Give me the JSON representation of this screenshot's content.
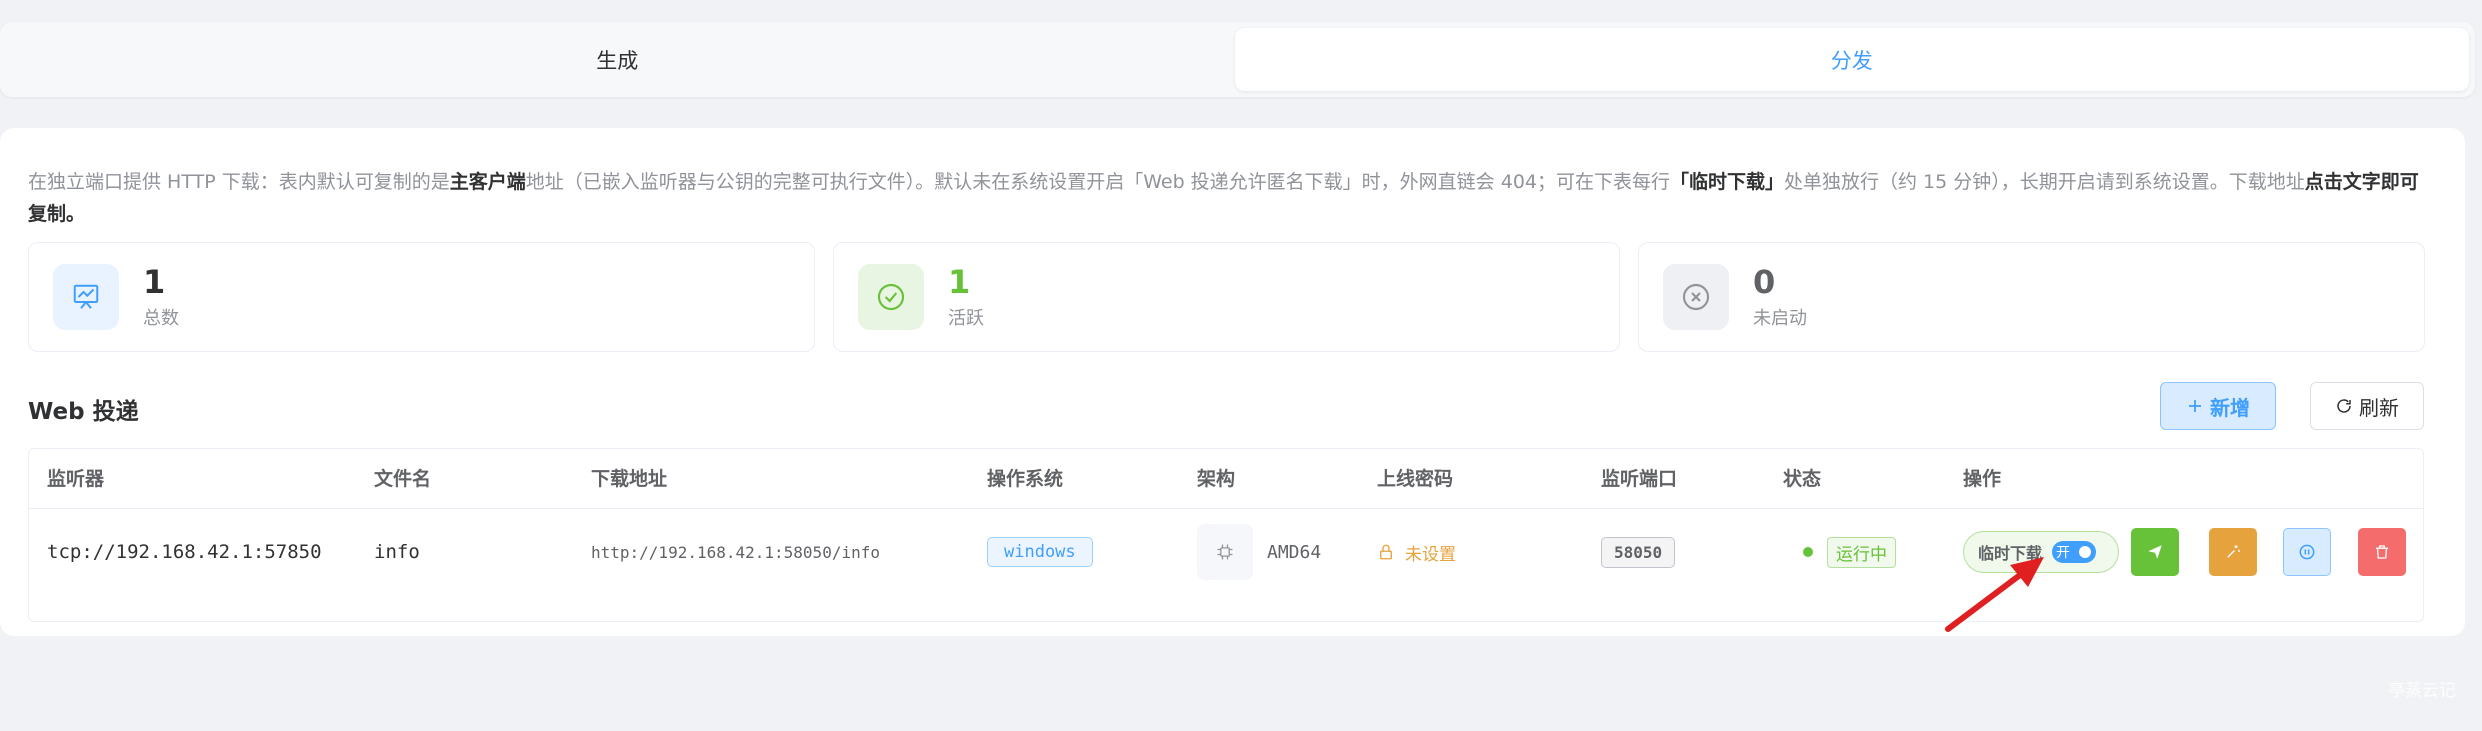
{
  "tabs": [
    {
      "label": "生成",
      "active": false
    },
    {
      "label": "分发",
      "active": true
    }
  ],
  "description": {
    "p1": "在独立端口提供 HTTP 下载：表内默认可复制的是",
    "b1": "主客户端",
    "p2": "地址（已嵌入监听器与公钥的完整可执行文件）。默认未在系统设置开启「Web 投递允许匿名下载」时，外网直链会 404；可在下表每行",
    "b2": "「临时下载」",
    "p3": "处单独放行（约 15 分钟），长期开启请到系统设置。下载地址",
    "b3": "点击文字即可复制。"
  },
  "stats": [
    {
      "value": "1",
      "label": "总数",
      "icon": "presentation-chart-icon",
      "color": "#409eff",
      "bg": "#e8f3ff"
    },
    {
      "value": "1",
      "label": "活跃",
      "icon": "check-circle-icon",
      "color": "#67c23a",
      "bg": "#e8f5e3"
    },
    {
      "value": "0",
      "label": "未启动",
      "icon": "x-circle-icon",
      "color": "#909399",
      "bg": "#eef0f3"
    }
  ],
  "section": {
    "title": "Web 投递",
    "add_label": "新增",
    "refresh_label": "刷新"
  },
  "table": {
    "headers": [
      "监听器",
      "文件名",
      "下载地址",
      "操作系统",
      "架构",
      "上线密码",
      "监听端口",
      "状态",
      "操作"
    ],
    "rows": [
      {
        "listener": "tcp://192.168.42.1:57850",
        "filename": "info",
        "url": "http://192.168.42.1:58050/info",
        "os": "windows",
        "arch": "AMD64",
        "password": "未设置",
        "port": "58050",
        "status": "运行中",
        "temp_download": "临时下载",
        "switch_label": "开"
      }
    ]
  },
  "colors": {
    "primary": "#409eff",
    "success": "#67c23a",
    "warning": "#e6a23c",
    "danger": "#f56c6c",
    "annotation_arrow": "#e02020"
  },
  "watermark": "亭蒸云记"
}
